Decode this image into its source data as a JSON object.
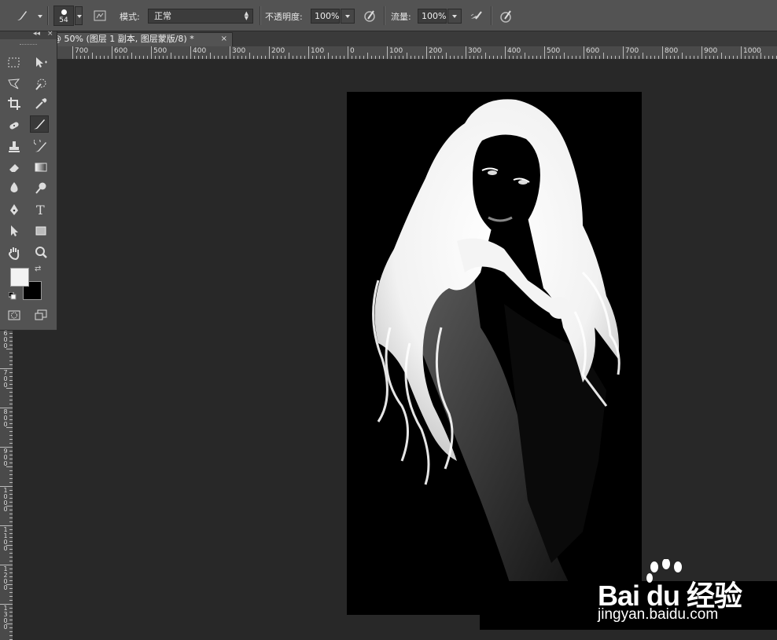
{
  "options_bar": {
    "brush_size": "54",
    "mode_label": "模式:",
    "mode_value": "正常",
    "opacity_label": "不透明度:",
    "opacity_value": "100%",
    "flow_label": "流量:",
    "flow_value": "100%"
  },
  "document_tab": {
    "title": "@ 50% (图层 1 副本, 图层蒙版/8) *",
    "close": "×"
  },
  "toolbox": {
    "collapse": "◂◂",
    "close": "×",
    "foreground_color": "#f2f2f2",
    "background_color": "#000000",
    "tools": [
      "move",
      "marquee",
      "lasso",
      "quick-selection",
      "crop",
      "eyedropper",
      "spot-healing",
      "brush",
      "clone-stamp",
      "history-brush",
      "eraser",
      "gradient",
      "blur",
      "dodge",
      "pen",
      "type",
      "path-selection",
      "rectangle",
      "hand",
      "zoom"
    ],
    "active_tool": "brush"
  },
  "ruler": {
    "h_labels": [
      "700",
      "600",
      "500",
      "400",
      "300",
      "200",
      "100",
      "0",
      "100",
      "200",
      "300",
      "400",
      "500",
      "600",
      "700",
      "800",
      "900",
      "1000"
    ],
    "v_labels": [
      "600",
      "700",
      "800",
      "900",
      "1000",
      "1100",
      "1200",
      "1300"
    ]
  },
  "watermark": {
    "brand": "Bai  du 经验",
    "url": "jingyan.baidu.com"
  }
}
